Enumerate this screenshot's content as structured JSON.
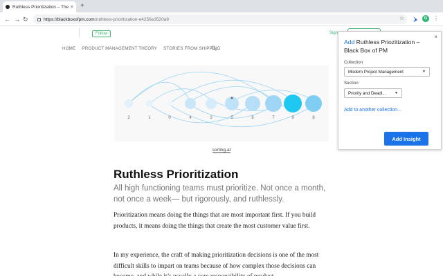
{
  "browser": {
    "tab_title": "Ruthless Prioritization – The B",
    "tab_close": "×",
    "new_tab": "+",
    "back": "←",
    "forward": "→",
    "reload": "↻",
    "url_host": "https://blackboxofpm.com",
    "url_path": "/ruthless-prioritization-e4256e3520a9",
    "star": "☆",
    "profile_initial": "G",
    "menu": "⋮"
  },
  "site": {
    "follow_label": "Follow",
    "signin_label": "Sign",
    "nav": [
      "HOME",
      "PRODUCT MANAGEMENT THEORY",
      "STORIES FROM SHIPPING"
    ]
  },
  "figure": {
    "caption": "sorting.at",
    "bubble_labels": [
      "2",
      "1",
      "0",
      "4",
      "3",
      "5",
      "6",
      "7",
      "9",
      "8"
    ]
  },
  "article": {
    "title": "Ruthless Prioritization",
    "subtitle": "All high functioning teams must prioritize. Not once a month, not once a week— but rigorously, and ruthlessly.",
    "p1": "Prioritization means doing the things that are most important first. If you build products, it means doing the things that create the most customer value first.",
    "p2": "In my experience, the craft of making prioritization decisions is one of the most difficult skills to impart on teams because of how complex those decisions can become, and while it’s usually a core responsibility of product"
  },
  "popup": {
    "close": "×",
    "title_prefix": "Add",
    "title_rest": " Ruthless Priozitization – Black Box of PM",
    "collection_label": "Collection",
    "collection_value": "Modern Project Management",
    "section_label": "Section",
    "section_value": "Priority and Deadl...",
    "another_link": "Add to another collection...",
    "insight_button": "Add Insight"
  },
  "colors": {
    "accent": "#1a73e8",
    "medium_green": "#3cb371",
    "bubble_highlight": "#1ec8f0"
  }
}
